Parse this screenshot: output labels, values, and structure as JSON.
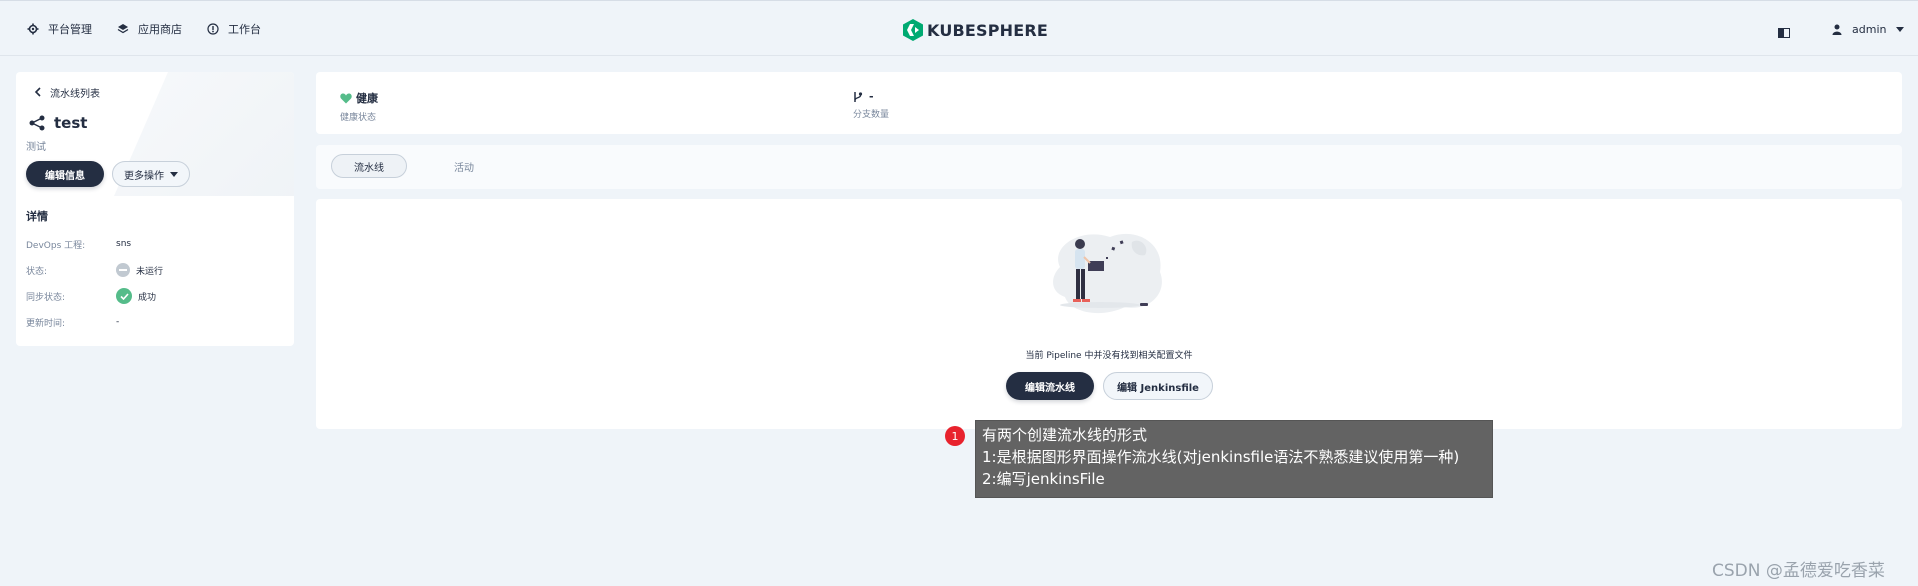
{
  "topbar": {
    "nav": [
      {
        "label": "平台管理",
        "icon": "gear-icon"
      },
      {
        "label": "应用商店",
        "icon": "layers-icon"
      },
      {
        "label": "工作台",
        "icon": "compass-icon"
      }
    ],
    "logo_text": "KUBESPHERE",
    "user": "admin"
  },
  "sidebar": {
    "back_label": "流水线列表",
    "pipeline_name": "test",
    "pipeline_desc": "测试",
    "edit_info_label": "编辑信息",
    "more_actions_label": "更多操作",
    "details_title": "详情",
    "details": [
      {
        "key": "DevOps 工程:",
        "value": "sns"
      },
      {
        "key": "状态:",
        "value": "未运行",
        "status": "idle"
      },
      {
        "key": "同步状态:",
        "value": "成功",
        "status": "success"
      },
      {
        "key": "更新时间:",
        "value": "-"
      }
    ]
  },
  "stats": {
    "health_value": "健康",
    "health_label": "健康状态",
    "branch_value": "-",
    "branch_label": "分支数量"
  },
  "tabs": [
    {
      "label": "流水线",
      "active": true
    },
    {
      "label": "活动",
      "active": false
    }
  ],
  "main": {
    "empty_message": "当前 Pipeline 中并没有找到相关配置文件",
    "edit_pipeline_label": "编辑流水线",
    "edit_jenkinsfile_label": "编辑 Jenkinsfile"
  },
  "annotation": {
    "badge": "1",
    "lines": [
      "有两个创建流水线的形式",
      "1:是根据图形界面操作流水线(对jenkinsfile语法不熟悉建议使用第一种)",
      "2:编写jenkinsFile"
    ]
  },
  "watermark": "CSDN @孟德爱吃香菜",
  "colors": {
    "primary": "#242e42",
    "success": "#55bc8a",
    "badge": "#e8222d",
    "background": "#eff4f9"
  }
}
